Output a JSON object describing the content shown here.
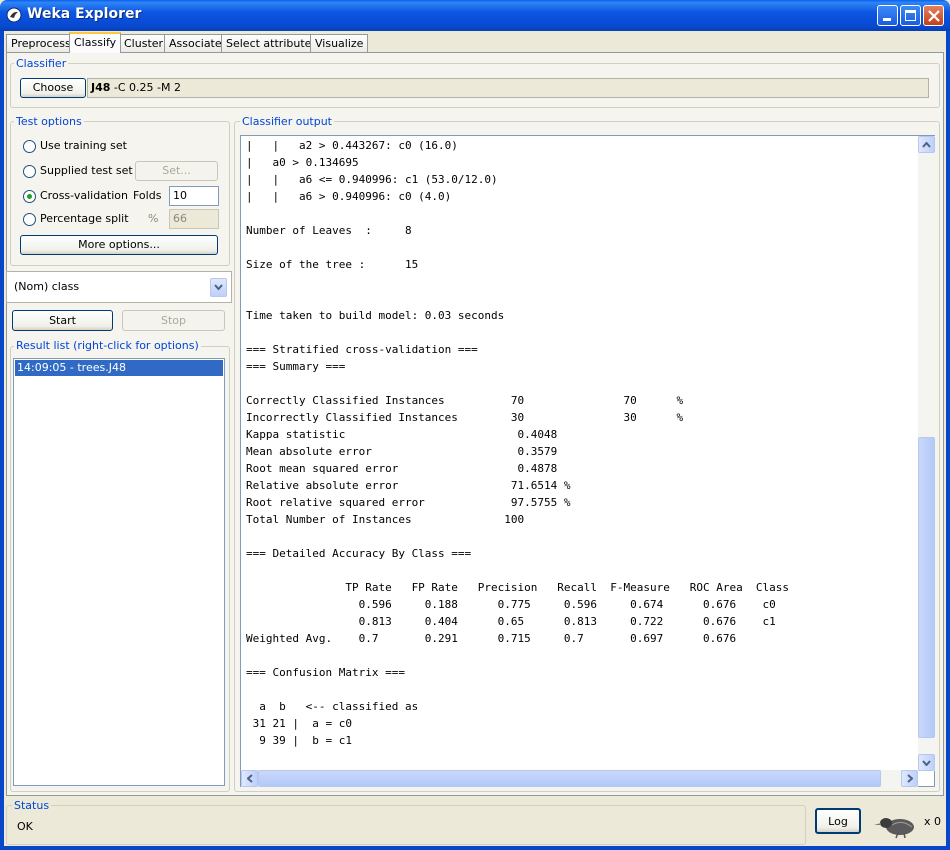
{
  "window": {
    "title": "Weka Explorer"
  },
  "tabs": [
    {
      "label": "Preprocess"
    },
    {
      "label": "Classify"
    },
    {
      "label": "Cluster"
    },
    {
      "label": "Associate"
    },
    {
      "label": "Select attributes"
    },
    {
      "label": "Visualize"
    }
  ],
  "classifier": {
    "group_title": "Classifier",
    "choose_label": "Choose",
    "name": "J48",
    "options": " -C 0.25 -M 2"
  },
  "test_options": {
    "group_title": "Test options",
    "use_training_set": "Use training set",
    "supplied_test_set": "Supplied test set",
    "set_button": "Set...",
    "cross_validation": "Cross-validation",
    "folds_label": "Folds",
    "folds_value": "10",
    "percentage_split": "Percentage split",
    "percent_symbol": "%",
    "percent_value": "66",
    "more_options": "More options..."
  },
  "class_select": {
    "value": "(Nom) class"
  },
  "controls": {
    "start": "Start",
    "stop": "Stop"
  },
  "result_list": {
    "group_title": "Result list (right-click for options)",
    "items": [
      {
        "label": "14:09:05 - trees.J48"
      }
    ]
  },
  "output": {
    "group_title": "Classifier output",
    "lines": [
      "|   |   a2 > 0.443267: c0 (16.0)",
      "|   a0 > 0.134695",
      "|   |   a6 <= 0.940996: c1 (53.0/12.0)",
      "|   |   a6 > 0.940996: c0 (4.0)",
      "",
      "Number of Leaves  :     8",
      "",
      "Size of the tree :      15",
      "",
      "",
      "Time taken to build model: 0.03 seconds",
      "",
      "=== Stratified cross-validation ===",
      "=== Summary ===",
      "",
      "Correctly Classified Instances          70               70      %",
      "Incorrectly Classified Instances        30               30      %",
      "Kappa statistic                          0.4048",
      "Mean absolute error                      0.3579",
      "Root mean squared error                  0.4878",
      "Relative absolute error                 71.6514 %",
      "Root relative squared error             97.5755 %",
      "Total Number of Instances              100",
      "",
      "=== Detailed Accuracy By Class ===",
      "",
      "               TP Rate   FP Rate   Precision   Recall  F-Measure   ROC Area  Class",
      "                 0.596     0.188      0.775     0.596     0.674      0.676    c0",
      "                 0.813     0.404      0.65      0.813     0.722      0.676    c1",
      "Weighted Avg.    0.7       0.291      0.715     0.7       0.697      0.676",
      "",
      "=== Confusion Matrix ===",
      "",
      "  a  b   <-- classified as",
      " 31 21 |  a = c0",
      "  9 39 |  b = c1"
    ]
  },
  "status": {
    "group_title": "Status",
    "text": "OK",
    "log_button": "Log",
    "x_count": "x 0"
  }
}
